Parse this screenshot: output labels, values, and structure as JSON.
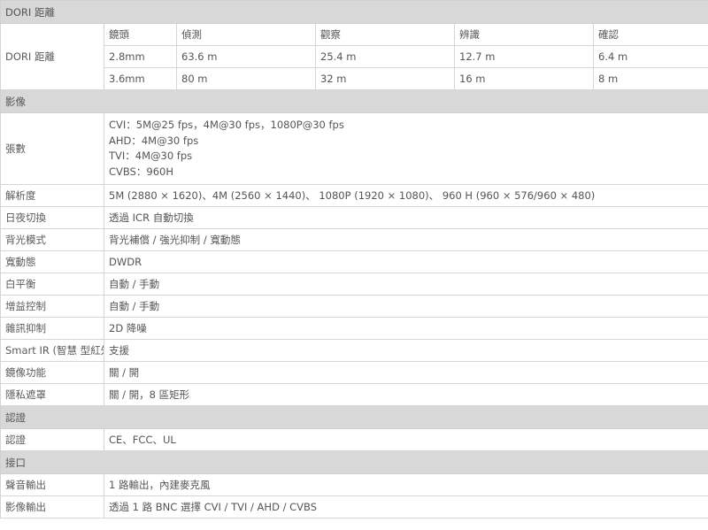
{
  "dori": {
    "section_title": "DORI 距離",
    "row_label": "DORI 距離",
    "headers": [
      "鏡頭",
      "偵測",
      "觀察",
      "辨識",
      "確認"
    ],
    "rows": [
      [
        "2.8mm",
        "63.6 m",
        "25.4 m",
        "12.7 m",
        "6.4 m"
      ],
      [
        "3.6mm",
        "80 m",
        "32 m",
        "16 m",
        "8 m"
      ]
    ]
  },
  "image": {
    "section_title": "影像",
    "resolution_label": "張數",
    "resolution_lines": [
      "CVI：5M@25 fps，4M@30 fps，1080P@30 fps",
      "AHD：4M@30 fps",
      "TVI：4M@30 fps",
      "CVBS：960H"
    ],
    "specs": [
      {
        "label": "解析度",
        "value": "5M (2880 × 1620)、4M (2560 × 1440)、 1080P (1920 × 1080)、 960 H (960 × 576/960 × 480)"
      },
      {
        "label": "日夜切換",
        "value": "透過 ICR 自動切換"
      },
      {
        "label": "背光模式",
        "value": "背光補償 / 強光抑制 / 寬動態"
      },
      {
        "label": "寬動態",
        "value": "DWDR"
      },
      {
        "label": "白平衡",
        "value": "自動 / 手動"
      },
      {
        "label": "增益控制",
        "value": "自動 / 手動"
      },
      {
        "label": "雜訊抑制",
        "value": "2D 降噪"
      },
      {
        "label": "Smart IR (智慧 型紅外線)",
        "value": "支援"
      },
      {
        "label": "鏡像功能",
        "value": "關 / 開"
      },
      {
        "label": "隱私遮罩",
        "value": "關 / 開，8 區矩形"
      }
    ]
  },
  "certification": {
    "section_title": "認證",
    "specs": [
      {
        "label": "認證",
        "value": "CE、FCC、UL"
      }
    ]
  },
  "interface": {
    "section_title": "接口",
    "specs": [
      {
        "label": "聲音輸出",
        "value": "1 路輸出，內建麥克風"
      },
      {
        "label": "影像輸出",
        "value": "透過 1 路 BNC 選擇 CVI / TVI / AHD / CVBS"
      }
    ]
  }
}
